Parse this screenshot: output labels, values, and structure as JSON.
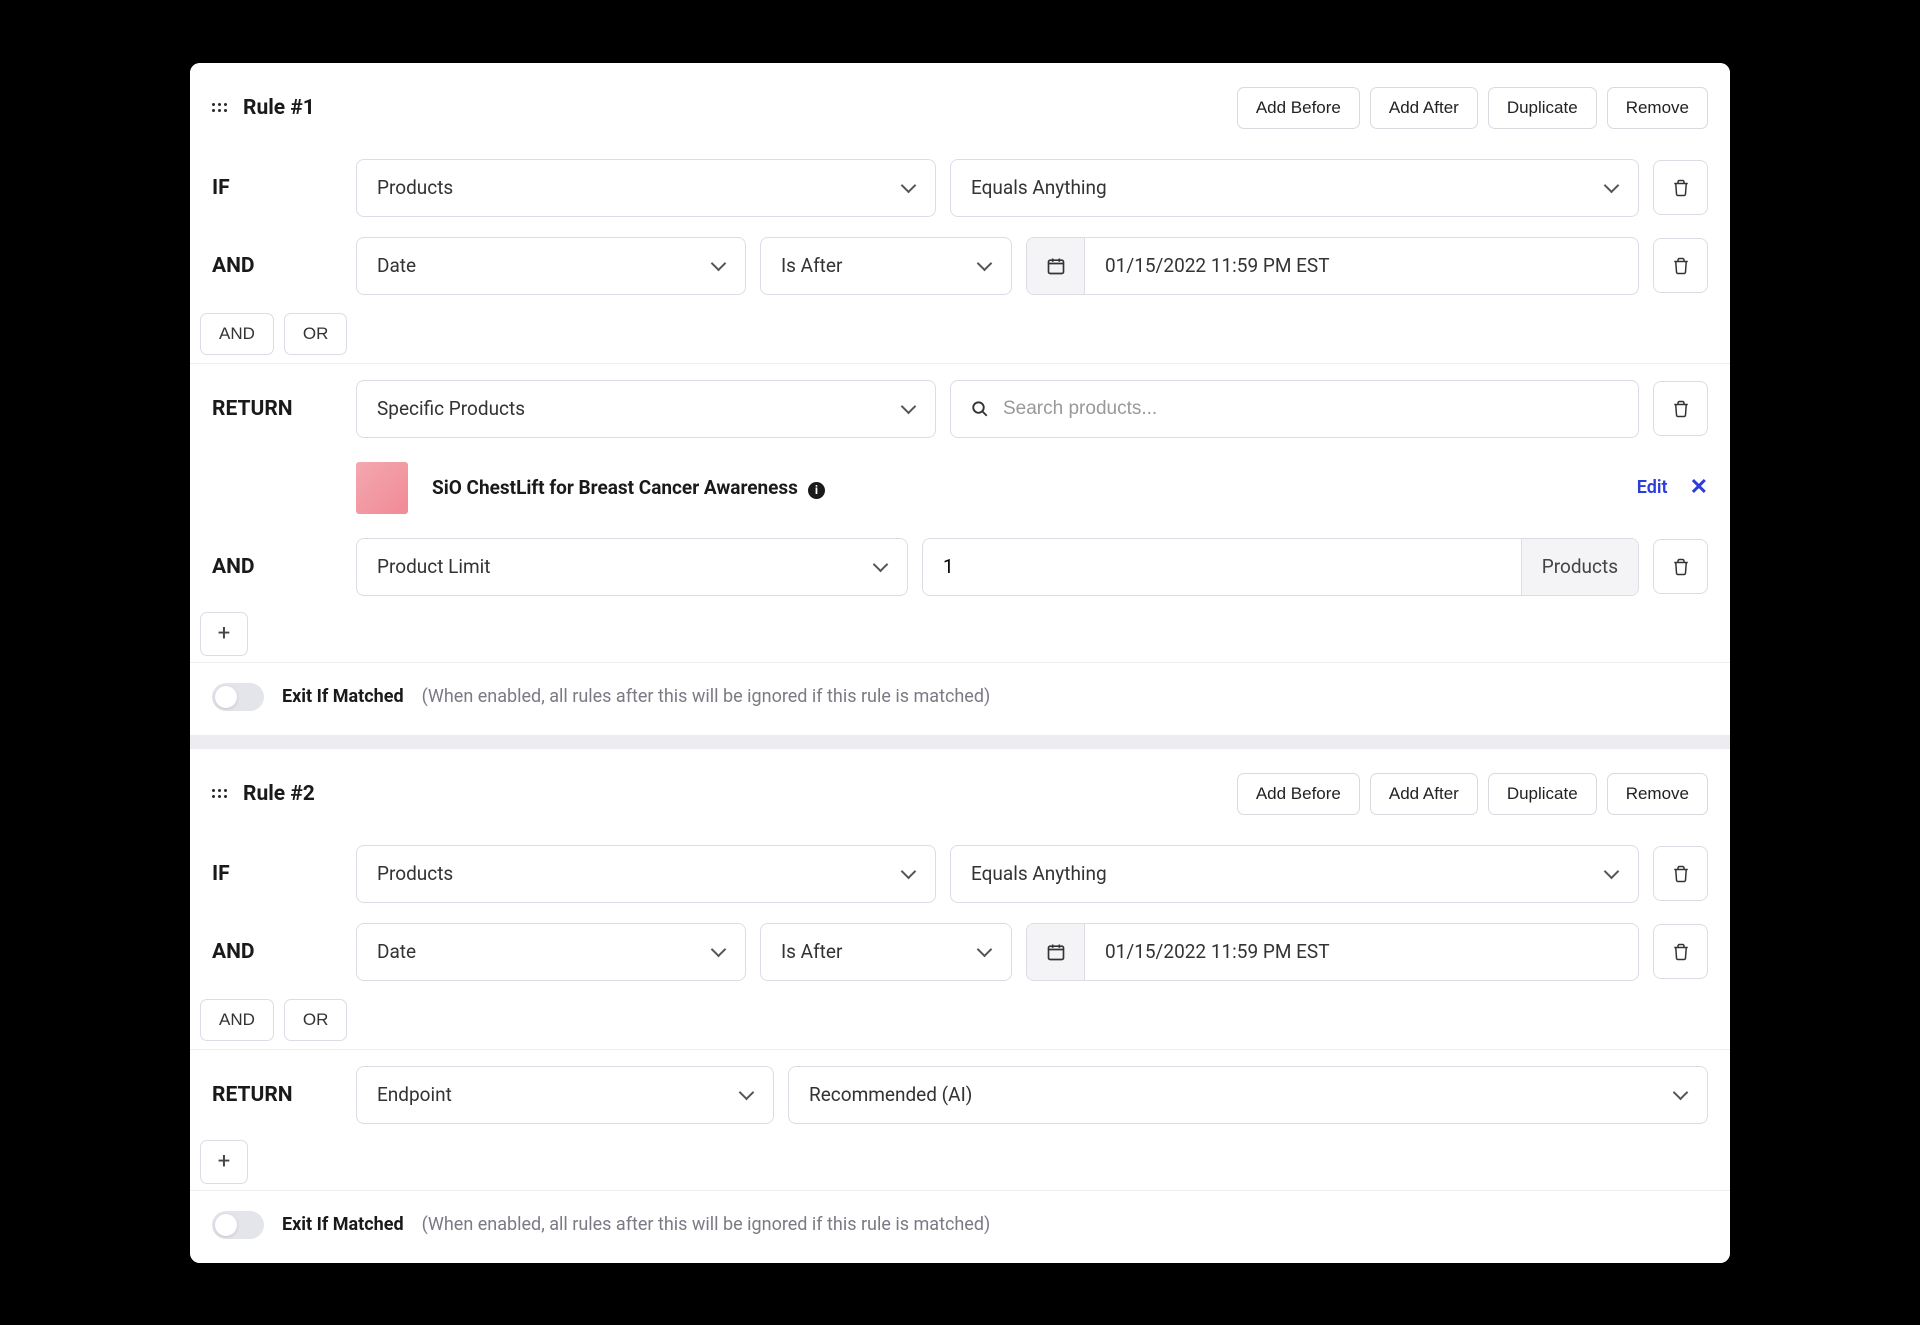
{
  "common": {
    "actions": {
      "add_before": "Add Before",
      "add_after": "Add After",
      "duplicate": "Duplicate",
      "remove": "Remove"
    },
    "connectors": {
      "and": "AND",
      "or": "OR"
    },
    "labels": {
      "if": "IF",
      "and": "AND",
      "return": "RETURN"
    },
    "footer": {
      "label": "Exit If Matched",
      "hint": "(When enabled, all rules after this will be ignored if this rule is matched)"
    },
    "add": "+"
  },
  "rule1": {
    "title": "Rule #1",
    "if_products": "Products",
    "if_equals": "Equals Anything",
    "and_date_label": "Date",
    "and_date_op": "Is After",
    "and_date_value": "01/15/2022 11:59 PM EST",
    "return_type": "Specific Products",
    "search_placeholder": "Search products...",
    "product_name": "SiO ChestLift for Breast Cancer Awareness",
    "edit": "Edit",
    "limit_label": "Product Limit",
    "limit_value": "1",
    "limit_unit": "Products"
  },
  "rule2": {
    "title": "Rule #2",
    "if_products": "Products",
    "if_equals": "Equals Anything",
    "and_date_label": "Date",
    "and_date_op": "Is After",
    "and_date_value": "01/15/2022 11:59 PM EST",
    "return_type": "Endpoint",
    "return_value": "Recommended (AI)"
  }
}
